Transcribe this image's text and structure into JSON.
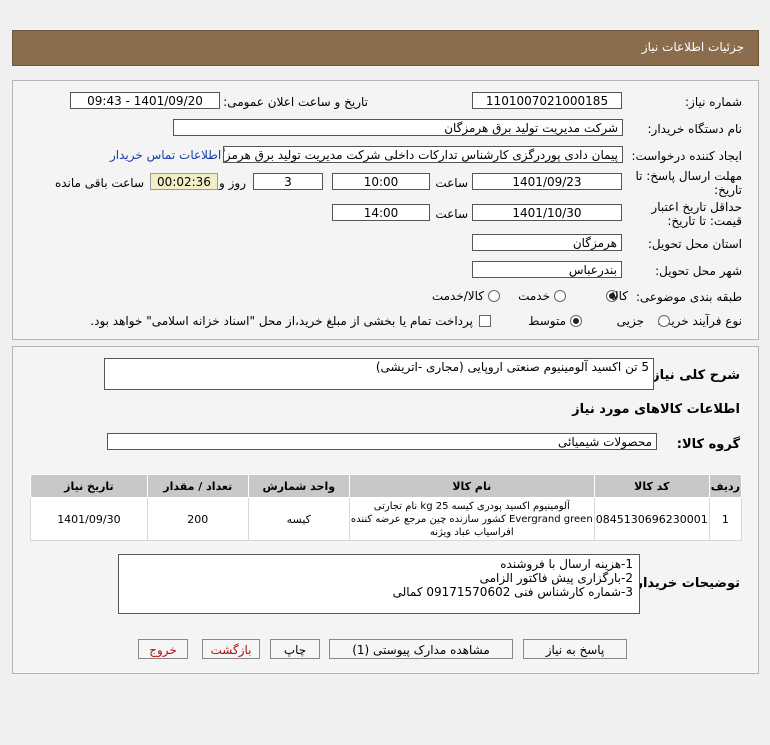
{
  "header": {
    "title": "جزئیات اطلاعات نیاز"
  },
  "form": {
    "need_number_label": "شماره نیاز:",
    "need_number": "1101007021000185",
    "announce_label": "تاریخ و ساعت اعلان عمومی:",
    "announce_value": "1401/09/20 - 09:43",
    "buyer_org_label": "نام دستگاه خریدار:",
    "buyer_org": "شرکت مدیریت تولید برق هرمزگان",
    "creator_label": "ایجاد کننده درخواست:",
    "creator": "پیمان دادی پوردرگزی کارشناس تدارکات داخلی شرکت مدیریت تولید برق هرمزگا",
    "contact_link": "اطلاعات تماس خریدار",
    "reply_deadline_label_1": "مهلت ارسال پاسخ: تا",
    "reply_deadline_label_2": "تاریخ:",
    "reply_date": "1401/09/23",
    "time_label": "ساعت",
    "reply_time": "10:00",
    "days_value": "3",
    "days_label": "روز و",
    "remaining_time": "00:02:36",
    "remaining_label": "ساعت باقی مانده",
    "validity_label_1": "حداقل تاریخ اعتبار",
    "validity_label_2": "قیمت: تا تاریخ:",
    "validity_date": "1401/10/30",
    "validity_time_label": "ساعت",
    "validity_time": "14:00",
    "province_label": "استان محل تحویل:",
    "province": "هرمزگان",
    "city_label": "شهر محل تحویل:",
    "city": "بندرعباس",
    "category_label": "طبقه بندی موضوعی:",
    "category_options": [
      "کالا",
      "خدمت",
      "کالا/خدمت"
    ],
    "category_selected": "کالا",
    "process_label": "نوع فرآیند خرید :",
    "process_options": [
      "جزیی",
      "متوسط"
    ],
    "process_selected": "متوسط",
    "payment_note": "پرداخت تمام یا بخشی از مبلغ خرید،از محل \"اسناد خزانه اسلامی\" خواهد بود."
  },
  "summary": {
    "label": "شرح کلی نیاز:",
    "value": "5 تن اکسید آلومینیوم صنعتی اروپایی (مجاری -اتریشی)"
  },
  "goods": {
    "section_title": "اطلاعات کالاهای مورد نیاز",
    "group_label": "گروه کالا:",
    "group_value": "محصولات شیمیائی",
    "columns": [
      "ردیف",
      "کد کالا",
      "نام کالا",
      "واحد شمارش",
      "تعداد / مقدار",
      "تاریخ نیاز"
    ],
    "rows": [
      {
        "row": "1",
        "code": "0845130696230001",
        "name": "آلومینیوم اکسید پودری کیسه 25 kg نام تجارتی Evergrand green کشور سازنده چین مرجع عرضه کننده افراسیاب عباد ویژنه",
        "unit": "کیسه",
        "qty": "200",
        "date": "1401/09/30"
      }
    ]
  },
  "notes": {
    "label": "توضیحات خریدار:",
    "lines": [
      "1-هزینه ارسال با فروشنده",
      "2-بارگزاری پیش فاکتور الزامی",
      "3-شماره کارشناس فنی 09171570602 کمالی"
    ]
  },
  "buttons": {
    "reply": "پاسخ به نیاز",
    "attachments": "مشاهده مدارک پیوستی (1)",
    "print": "چاپ",
    "back": "بازگشت",
    "exit": "خروج"
  },
  "colors": {
    "header": "#8b6d4e",
    "link": "#1a3ea8",
    "exit_text": "#b01010"
  }
}
